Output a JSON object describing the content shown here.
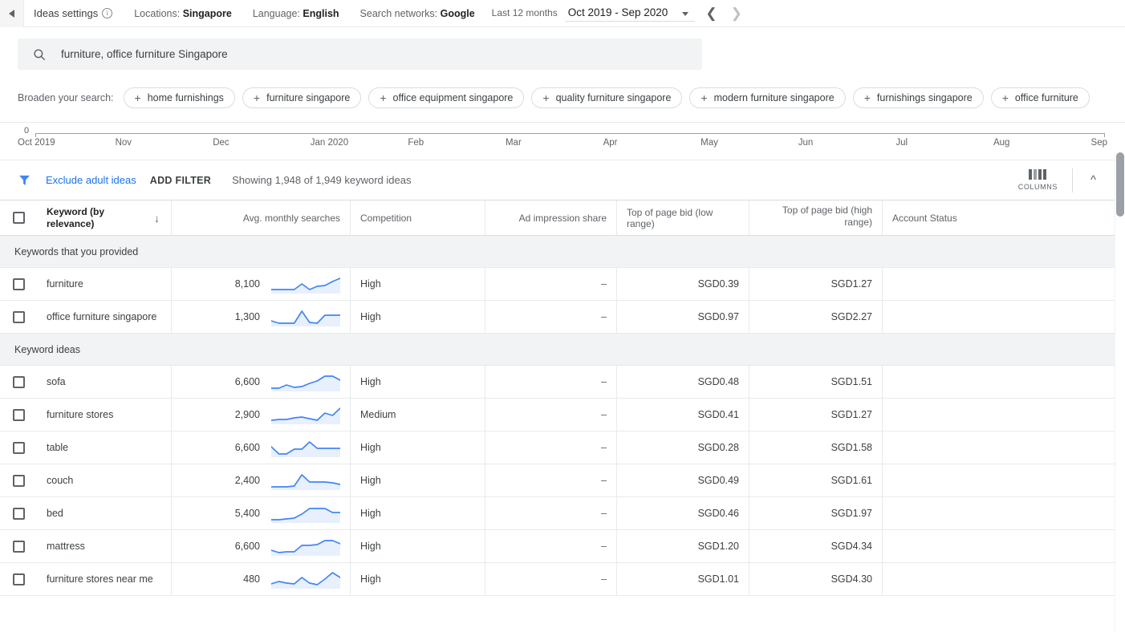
{
  "topbar": {
    "collapse_icon": "triangle-left-icon",
    "ideas_settings_label": "Ideas settings",
    "info_icon": "info-icon",
    "locations_label": "Locations:",
    "locations_value": "Singapore",
    "language_label": "Language:",
    "language_value": "English",
    "networks_label": "Search networks:",
    "networks_value": "Google",
    "daterange_label": "Last 12 months",
    "daterange_value": "Oct 2019 - Sep 2020",
    "caret_icon": "chevron-down-icon",
    "prev_icon": "chevron-left-icon",
    "next_icon": "chevron-right-icon"
  },
  "search": {
    "icon": "search-icon",
    "value": "furniture, office furniture Singapore"
  },
  "broaden": {
    "label": "Broaden your search:",
    "chips": [
      "home furnishings",
      "furniture singapore",
      "office equipment singapore",
      "quality furniture singapore",
      "modern furniture singapore",
      "furnishings singapore",
      "office furniture"
    ]
  },
  "chart_data": {
    "type": "line",
    "title": "",
    "xlabel": "",
    "ylabel": "",
    "zero_label": "0",
    "categories": [
      "Oct 2019",
      "Nov",
      "Dec",
      "Jan 2020",
      "Feb",
      "Mar",
      "Apr",
      "May",
      "Jun",
      "Jul",
      "Aug",
      "Sep"
    ],
    "values": [],
    "ylim": [
      0,
      0
    ],
    "grid": false,
    "note": "Trend chart is scrolled out of view; only the zero baseline and month axis labels are visible."
  },
  "filterbar": {
    "funnel_icon": "filter-funnel-icon",
    "exclude_adult": "Exclude adult ideas",
    "add_filter": "ADD FILTER",
    "showing": "Showing 1,948 of 1,949 keyword ideas",
    "columns_icon": "columns-icon",
    "columns_label": "COLUMNS",
    "collapse_icon": "chevron-up-icon"
  },
  "table": {
    "headers": {
      "keyword": "Keyword (by relevance)",
      "sort_icon": "arrow-down-icon",
      "searches": "Avg. monthly searches",
      "competition": "Competition",
      "ad_share": "Ad impression share",
      "bid_low": "Top of page bid (low range)",
      "bid_high": "Top of page bid (high range)",
      "account_status": "Account Status"
    },
    "groups": [
      {
        "label": "Keywords that you provided",
        "rows": [
          {
            "keyword": "furniture",
            "searches": "8,100",
            "competition": "High",
            "ad_share": "–",
            "bid_low": "SGD0.39",
            "bid_high": "SGD1.27",
            "account_status": "",
            "spark": [
              4,
              4,
              4,
              4,
              11,
              4,
              8,
              9,
              14,
              18
            ]
          },
          {
            "keyword": "office furniture singapore",
            "searches": "1,300",
            "competition": "High",
            "ad_share": "–",
            "bid_low": "SGD0.97",
            "bid_high": "SGD2.27",
            "account_status": "",
            "spark": [
              6,
              3,
              3,
              3,
              18,
              4,
              3,
              13,
              13,
              13
            ]
          }
        ]
      },
      {
        "label": "Keyword ideas",
        "rows": [
          {
            "keyword": "sofa",
            "searches": "6,600",
            "competition": "High",
            "ad_share": "–",
            "bid_low": "SGD0.48",
            "bid_high": "SGD1.51",
            "account_status": "",
            "spark": [
              3,
              3,
              7,
              4,
              5,
              9,
              12,
              18,
              18,
              13
            ]
          },
          {
            "keyword": "furniture stores",
            "searches": "2,900",
            "competition": "Medium",
            "ad_share": "–",
            "bid_low": "SGD0.41",
            "bid_high": "SGD1.27",
            "account_status": "",
            "spark": [
              4,
              5,
              5,
              7,
              8,
              6,
              4,
              13,
              10,
              19
            ]
          },
          {
            "keyword": "table",
            "searches": "6,600",
            "competition": "High",
            "ad_share": "–",
            "bid_low": "SGD0.28",
            "bid_high": "SGD1.58",
            "account_status": "",
            "spark": [
              12,
              3,
              3,
              9,
              9,
              18,
              10,
              10,
              10,
              10
            ]
          },
          {
            "keyword": "couch",
            "searches": "2,400",
            "competition": "High",
            "ad_share": "–",
            "bid_low": "SGD0.49",
            "bid_high": "SGD1.61",
            "account_status": "",
            "spark": [
              3,
              3,
              3,
              4,
              18,
              9,
              9,
              9,
              8,
              6
            ]
          },
          {
            "keyword": "bed",
            "searches": "5,400",
            "competition": "High",
            "ad_share": "–",
            "bid_low": "SGD0.46",
            "bid_high": "SGD1.97",
            "account_status": "",
            "spark": [
              3,
              3,
              4,
              5,
              10,
              17,
              17,
              17,
              12,
              12
            ]
          },
          {
            "keyword": "mattress",
            "searches": "6,600",
            "competition": "High",
            "ad_share": "–",
            "bid_low": "SGD1.20",
            "bid_high": "SGD4.34",
            "account_status": "",
            "spark": [
              6,
              3,
              4,
              4,
              12,
              12,
              13,
              18,
              18,
              14
            ]
          },
          {
            "keyword": "furniture stores near me",
            "searches": "480",
            "competition": "High",
            "ad_share": "–",
            "bid_low": "SGD1.01",
            "bid_high": "SGD4.30",
            "account_status": "",
            "spark": [
              5,
              8,
              6,
              5,
              13,
              6,
              4,
              11,
              19,
              13
            ]
          }
        ]
      }
    ]
  },
  "scrollbar": {
    "thumb": "vertical-scroll-thumb"
  }
}
